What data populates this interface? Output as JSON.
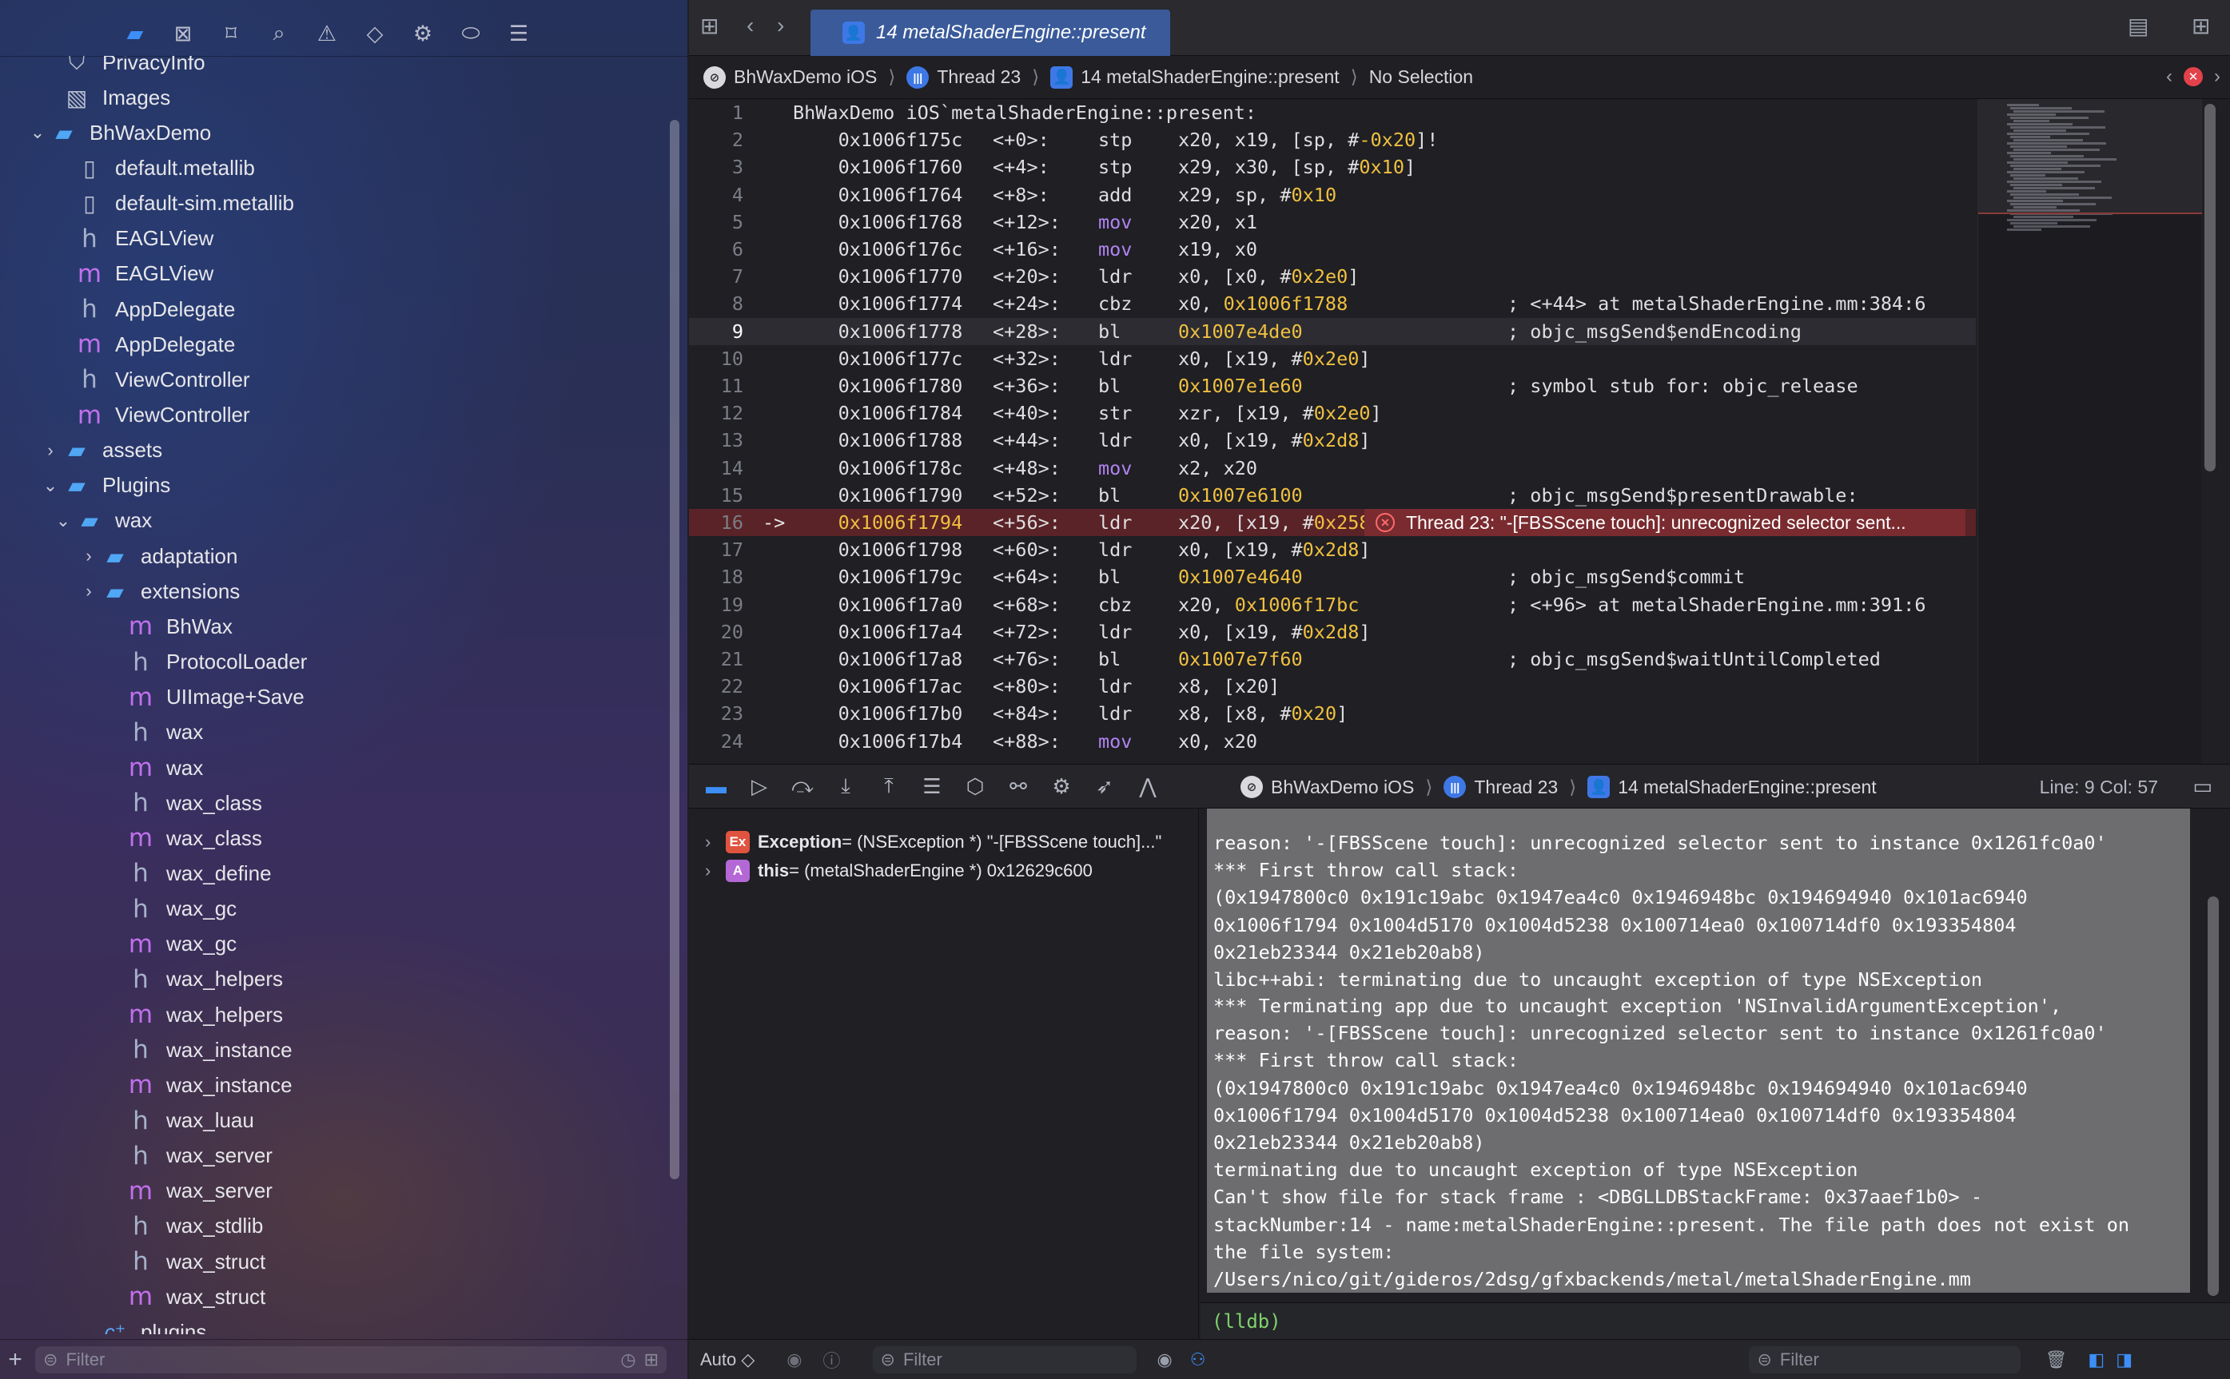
{
  "navigator": {
    "toolbar_icons": [
      "folder-icon",
      "source-control-icon",
      "bookmark-icon",
      "find-icon",
      "issue-icon",
      "test-icon",
      "debug-icon",
      "breakpoint-icon",
      "report-icon"
    ],
    "items": [
      {
        "label": "PrivacyInfo",
        "icon": "privacy-icon",
        "indent": 1,
        "disclosure": ""
      },
      {
        "label": "Images",
        "icon": "image-icon",
        "indent": 1,
        "disclosure": ""
      },
      {
        "label": "BhWaxDemo",
        "icon": "folder-icon",
        "indent": 0,
        "disclosure": "open"
      },
      {
        "label": "default.metallib",
        "icon": "doc-icon",
        "indent": 2,
        "disclosure": ""
      },
      {
        "label": "default-sim.metallib",
        "icon": "doc-icon",
        "indent": 2,
        "disclosure": ""
      },
      {
        "label": "EAGLView",
        "icon": "h-file-icon",
        "indent": 2,
        "disclosure": ""
      },
      {
        "label": "EAGLView",
        "icon": "m-file-icon",
        "indent": 2,
        "disclosure": ""
      },
      {
        "label": "AppDelegate",
        "icon": "h-file-icon",
        "indent": 2,
        "disclosure": ""
      },
      {
        "label": "AppDelegate",
        "icon": "m-file-icon",
        "indent": 2,
        "disclosure": ""
      },
      {
        "label": "ViewController",
        "icon": "h-file-icon",
        "indent": 2,
        "disclosure": ""
      },
      {
        "label": "ViewController",
        "icon": "m-file-icon",
        "indent": 2,
        "disclosure": ""
      },
      {
        "label": "assets",
        "icon": "folder-icon",
        "indent": 1,
        "disclosure": "closed"
      },
      {
        "label": "Plugins",
        "icon": "folder-icon",
        "indent": 1,
        "disclosure": "open"
      },
      {
        "label": "wax",
        "icon": "folder-icon",
        "indent": 2,
        "disclosure": "open"
      },
      {
        "label": "adaptation",
        "icon": "folder-icon",
        "indent": 3,
        "disclosure": "closed"
      },
      {
        "label": "extensions",
        "icon": "folder-icon",
        "indent": 3,
        "disclosure": "closed"
      },
      {
        "label": "BhWax",
        "icon": "m-file-icon",
        "indent": 4,
        "disclosure": ""
      },
      {
        "label": "ProtocolLoader",
        "icon": "h-file-icon",
        "indent": 4,
        "disclosure": ""
      },
      {
        "label": "UIImage+Save",
        "icon": "m-file-icon",
        "indent": 4,
        "disclosure": ""
      },
      {
        "label": "wax",
        "icon": "h-file-icon",
        "indent": 4,
        "disclosure": ""
      },
      {
        "label": "wax",
        "icon": "m-file-icon",
        "indent": 4,
        "disclosure": ""
      },
      {
        "label": "wax_class",
        "icon": "h-file-icon",
        "indent": 4,
        "disclosure": ""
      },
      {
        "label": "wax_class",
        "icon": "m-file-icon",
        "indent": 4,
        "disclosure": ""
      },
      {
        "label": "wax_define",
        "icon": "h-file-icon",
        "indent": 4,
        "disclosure": ""
      },
      {
        "label": "wax_gc",
        "icon": "h-file-icon",
        "indent": 4,
        "disclosure": ""
      },
      {
        "label": "wax_gc",
        "icon": "m-file-icon",
        "indent": 4,
        "disclosure": ""
      },
      {
        "label": "wax_helpers",
        "icon": "h-file-icon",
        "indent": 4,
        "disclosure": ""
      },
      {
        "label": "wax_helpers",
        "icon": "m-file-icon",
        "indent": 4,
        "disclosure": ""
      },
      {
        "label": "wax_instance",
        "icon": "h-file-icon",
        "indent": 4,
        "disclosure": ""
      },
      {
        "label": "wax_instance",
        "icon": "m-file-icon",
        "indent": 4,
        "disclosure": ""
      },
      {
        "label": "wax_luau",
        "icon": "h-file-icon",
        "indent": 4,
        "disclosure": ""
      },
      {
        "label": "wax_server",
        "icon": "h-file-icon",
        "indent": 4,
        "disclosure": ""
      },
      {
        "label": "wax_server",
        "icon": "m-file-icon",
        "indent": 4,
        "disclosure": ""
      },
      {
        "label": "wax_stdlib",
        "icon": "h-file-icon",
        "indent": 4,
        "disclosure": ""
      },
      {
        "label": "wax_struct",
        "icon": "h-file-icon",
        "indent": 4,
        "disclosure": ""
      },
      {
        "label": "wax_struct",
        "icon": "m-file-icon",
        "indent": 4,
        "disclosure": ""
      },
      {
        "label": "plugins",
        "icon": "c-file-icon",
        "indent": 3,
        "disclosure": ""
      }
    ],
    "filter_placeholder": "Filter"
  },
  "editor": {
    "active_tab": "14 metalShaderEngine::present",
    "breadcrumb": [
      "BhWaxDemo iOS",
      "Thread 23",
      "14 metalShaderEngine::present",
      "No Selection"
    ],
    "current_line": 9,
    "error_line": 16,
    "error_message": "Thread 23: \"-[FBSScene touch]: unrecognized selector sent...",
    "lines": [
      {
        "n": "1",
        "addr": "BhWaxDemo iOS`metalShaderEngine::present:",
        "off": "",
        "op": "",
        "args": "",
        "cmt": ""
      },
      {
        "n": "2",
        "addr": "    0x1006f175c",
        "off": "<+0>:",
        "op": "stp",
        "args": "x20, x19, [sp, #-0x20]!",
        "cmt": ""
      },
      {
        "n": "3",
        "addr": "    0x1006f1760",
        "off": "<+4>:",
        "op": "stp",
        "args": "x29, x30, [sp, #0x10]",
        "cmt": ""
      },
      {
        "n": "4",
        "addr": "    0x1006f1764",
        "off": "<+8>:",
        "op": "add",
        "args": "x29, sp, #0x10",
        "cmt": ""
      },
      {
        "n": "5",
        "addr": "    0x1006f1768",
        "off": "<+12>:",
        "op": "mov",
        "args": "x20, x1",
        "cmt": ""
      },
      {
        "n": "6",
        "addr": "    0x1006f176c",
        "off": "<+16>:",
        "op": "mov",
        "args": "x19, x0",
        "cmt": ""
      },
      {
        "n": "7",
        "addr": "    0x1006f1770",
        "off": "<+20>:",
        "op": "ldr",
        "args": "x0, [x0, #0x2e0]",
        "cmt": ""
      },
      {
        "n": "8",
        "addr": "    0x1006f1774",
        "off": "<+24>:",
        "op": "cbz",
        "args": "x0, 0x1006f1788",
        "cmt": "; <+44> at metalShaderEngine.mm:384:6"
      },
      {
        "n": "9",
        "addr": "    0x1006f1778",
        "off": "<+28>:",
        "op": "bl",
        "args": "0x1007e4de0",
        "cmt": "; objc_msgSend$endEncoding"
      },
      {
        "n": "10",
        "addr": "    0x1006f177c",
        "off": "<+32>:",
        "op": "ldr",
        "args": "x0, [x19, #0x2e0]",
        "cmt": ""
      },
      {
        "n": "11",
        "addr": "    0x1006f1780",
        "off": "<+36>:",
        "op": "bl",
        "args": "0x1007e1e60",
        "cmt": "; symbol stub for: objc_release"
      },
      {
        "n": "12",
        "addr": "    0x1006f1784",
        "off": "<+40>:",
        "op": "str",
        "args": "xzr, [x19, #0x2e0]",
        "cmt": ""
      },
      {
        "n": "13",
        "addr": "    0x1006f1788",
        "off": "<+44>:",
        "op": "ldr",
        "args": "x0, [x19, #0x2d8]",
        "cmt": ""
      },
      {
        "n": "14",
        "addr": "    0x1006f178c",
        "off": "<+48>:",
        "op": "mov",
        "args": "x2, x20",
        "cmt": ""
      },
      {
        "n": "15",
        "addr": "    0x1006f1790",
        "off": "<+52>:",
        "op": "bl",
        "args": "0x1007e6100",
        "cmt": "; objc_msgSend$presentDrawable:"
      },
      {
        "n": "16",
        "addr": "    0x1006f1794",
        "off": "<+56>:",
        "op": "ldr",
        "args": "x20, [x19, #0x258]",
        "cmt": ""
      },
      {
        "n": "17",
        "addr": "    0x1006f1798",
        "off": "<+60>:",
        "op": "ldr",
        "args": "x0, [x19, #0x2d8]",
        "cmt": ""
      },
      {
        "n": "18",
        "addr": "    0x1006f179c",
        "off": "<+64>:",
        "op": "bl",
        "args": "0x1007e4640",
        "cmt": "; objc_msgSend$commit"
      },
      {
        "n": "19",
        "addr": "    0x1006f17a0",
        "off": "<+68>:",
        "op": "cbz",
        "args": "x20, 0x1006f17bc",
        "cmt": "; <+96> at metalShaderEngine.mm:391:6"
      },
      {
        "n": "20",
        "addr": "    0x1006f17a4",
        "off": "<+72>:",
        "op": "ldr",
        "args": "x0, [x19, #0x2d8]",
        "cmt": ""
      },
      {
        "n": "21",
        "addr": "    0x1006f17a8",
        "off": "<+76>:",
        "op": "bl",
        "args": "0x1007e7f60",
        "cmt": "; objc_msgSend$waitUntilCompleted"
      },
      {
        "n": "22",
        "addr": "    0x1006f17ac",
        "off": "<+80>:",
        "op": "ldr",
        "args": "x8, [x20]",
        "cmt": ""
      },
      {
        "n": "23",
        "addr": "    0x1006f17b0",
        "off": "<+84>:",
        "op": "ldr",
        "args": "x8, [x8, #0x20]",
        "cmt": ""
      },
      {
        "n": "24",
        "addr": "    0x1006f17b4",
        "off": "<+88>:",
        "op": "mov",
        "args": "x0, x20",
        "cmt": ""
      }
    ]
  },
  "debug_bar": {
    "breadcrumb": [
      "BhWaxDemo iOS",
      "Thread 23",
      "14 metalShaderEngine::present"
    ],
    "line_col": "Line: 9  Col: 57"
  },
  "variables": [
    {
      "badge": "Ex",
      "name": "Exception",
      "value": " = (NSException *) \"-[FBSScene touch]...\""
    },
    {
      "badge": "A",
      "name": "this",
      "value": " = (metalShaderEngine *) 0x12629c600"
    }
  ],
  "console": {
    "block1": [
      "reason: '-[FBSScene touch]: unrecognized selector sent to instance 0x1261fc0a0'",
      "*** First throw call stack:",
      "(0x1947800c0 0x191c19abc 0x1947ea4c0 0x1946948bc 0x194694940 0x101ac6940",
      "0x1006f1794 0x1004d5170 0x1004d5238 0x100714ea0 0x100714df0 0x193354804",
      "0x21eb23344 0x21eb20ab8)",
      "libc++abi: terminating due to uncaught exception of type NSException"
    ],
    "block2": [
      "*** Terminating app due to uncaught exception 'NSInvalidArgumentException',",
      "reason: '-[FBSScene touch]: unrecognized selector sent to instance 0x1261fc0a0'",
      "*** First throw call stack:",
      "(0x1947800c0 0x191c19abc 0x1947ea4c0 0x1946948bc 0x194694940 0x101ac6940",
      "0x1006f1794 0x1004d5170 0x1004d5238 0x100714ea0 0x100714df0 0x193354804",
      "0x21eb23344 0x21eb20ab8)",
      "terminating due to uncaught exception of type NSException",
      "Can't show file for stack frame : <DBGLLDBStackFrame: 0x37aaef1b0> -",
      "stackNumber:14 - name:metalShaderEngine::present. The file path does not exist on",
      "the file system:",
      "/Users/nico/git/gideros/2dsg/gfxbackends/metal/metalShaderEngine.mm"
    ],
    "prompt": "(lldb)"
  },
  "bottom": {
    "mode_label": "Auto ◇",
    "vars_filter_placeholder": "Filter",
    "console_filter_placeholder": "Filter"
  }
}
